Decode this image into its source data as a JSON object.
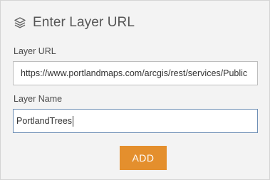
{
  "header": {
    "title": "Enter Layer URL",
    "icon": "layers-icon"
  },
  "form": {
    "url_label": "Layer URL",
    "url_value": "https://www.portlandmaps.com/arcgis/rest/services/Public",
    "name_label": "Layer Name",
    "name_value": "PortlandTrees"
  },
  "actions": {
    "add_label": "ADD"
  },
  "colors": {
    "panel_background": "#f3f3f3",
    "accent_button": "#e48f2d",
    "focused_border": "#6e8fb5"
  }
}
